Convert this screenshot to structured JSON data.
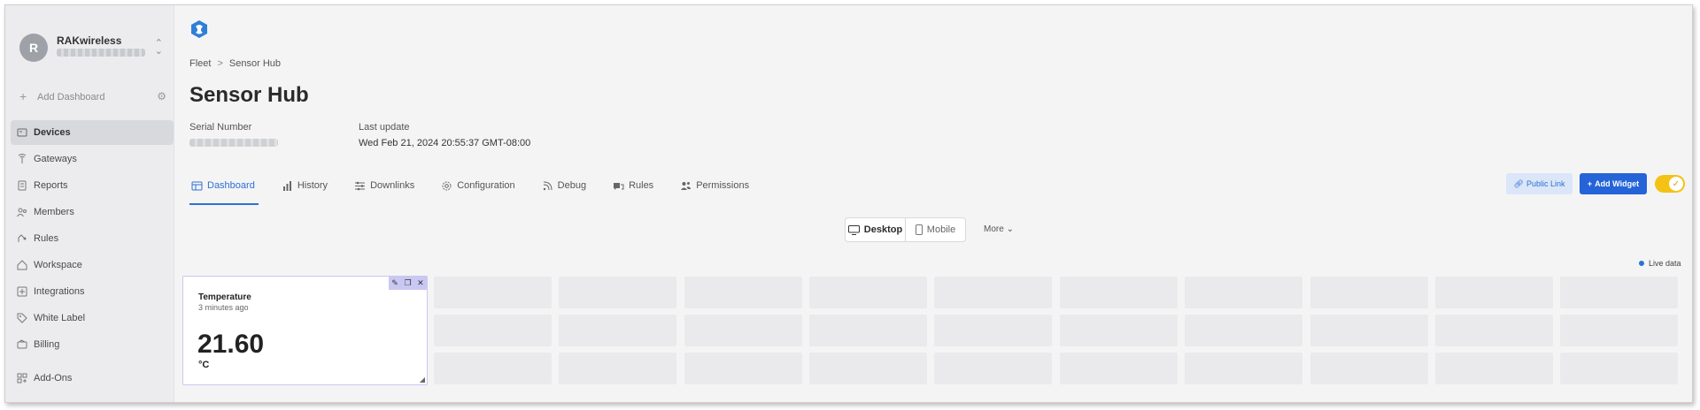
{
  "sidebar": {
    "account": {
      "initial": "R",
      "name": "RAKwireless"
    },
    "add_dashboard": "Add Dashboard",
    "items": [
      {
        "label": "Devices",
        "icon": "devices-icon",
        "active": true
      },
      {
        "label": "Gateways",
        "icon": "gateway-icon"
      },
      {
        "label": "Reports",
        "icon": "report-icon"
      },
      {
        "label": "Members",
        "icon": "members-icon"
      },
      {
        "label": "Rules",
        "icon": "rules-icon"
      },
      {
        "label": "Workspace",
        "icon": "workspace-icon"
      },
      {
        "label": "Integrations",
        "icon": "integrations-icon"
      },
      {
        "label": "White Label",
        "icon": "tag-icon"
      },
      {
        "label": "Billing",
        "icon": "billing-icon"
      },
      {
        "label": "Add-Ons",
        "icon": "addons-icon"
      }
    ]
  },
  "breadcrumb": {
    "parent": "Fleet",
    "sep": ">",
    "current": "Sensor Hub"
  },
  "page": {
    "title": "Sensor Hub",
    "serial_label": "Serial Number",
    "last_update_label": "Last update",
    "last_update_value": "Wed Feb 21, 2024 20:55:37 GMT-08:00"
  },
  "tabs": [
    {
      "label": "Dashboard",
      "icon": "dashboard-icon",
      "active": true
    },
    {
      "label": "History",
      "icon": "history-icon"
    },
    {
      "label": "Downlinks",
      "icon": "downlinks-icon"
    },
    {
      "label": "Configuration",
      "icon": "gear-icon"
    },
    {
      "label": "Debug",
      "icon": "debug-icon"
    },
    {
      "label": "Rules",
      "icon": "rules-icon"
    },
    {
      "label": "Permissions",
      "icon": "permissions-icon"
    }
  ],
  "actions": {
    "public_link": "Public Link",
    "add_widget": "Add Widget"
  },
  "view": {
    "desktop": "Desktop",
    "mobile": "Mobile",
    "more": "More"
  },
  "live_data": "Live data",
  "widget": {
    "title": "Temperature",
    "subtitle": "3 minutes ago",
    "value": "21.60",
    "unit": "°C"
  },
  "colors": {
    "accent": "#2563d8",
    "toggle": "#f3c215",
    "widget_border": "#c9c8f2"
  }
}
